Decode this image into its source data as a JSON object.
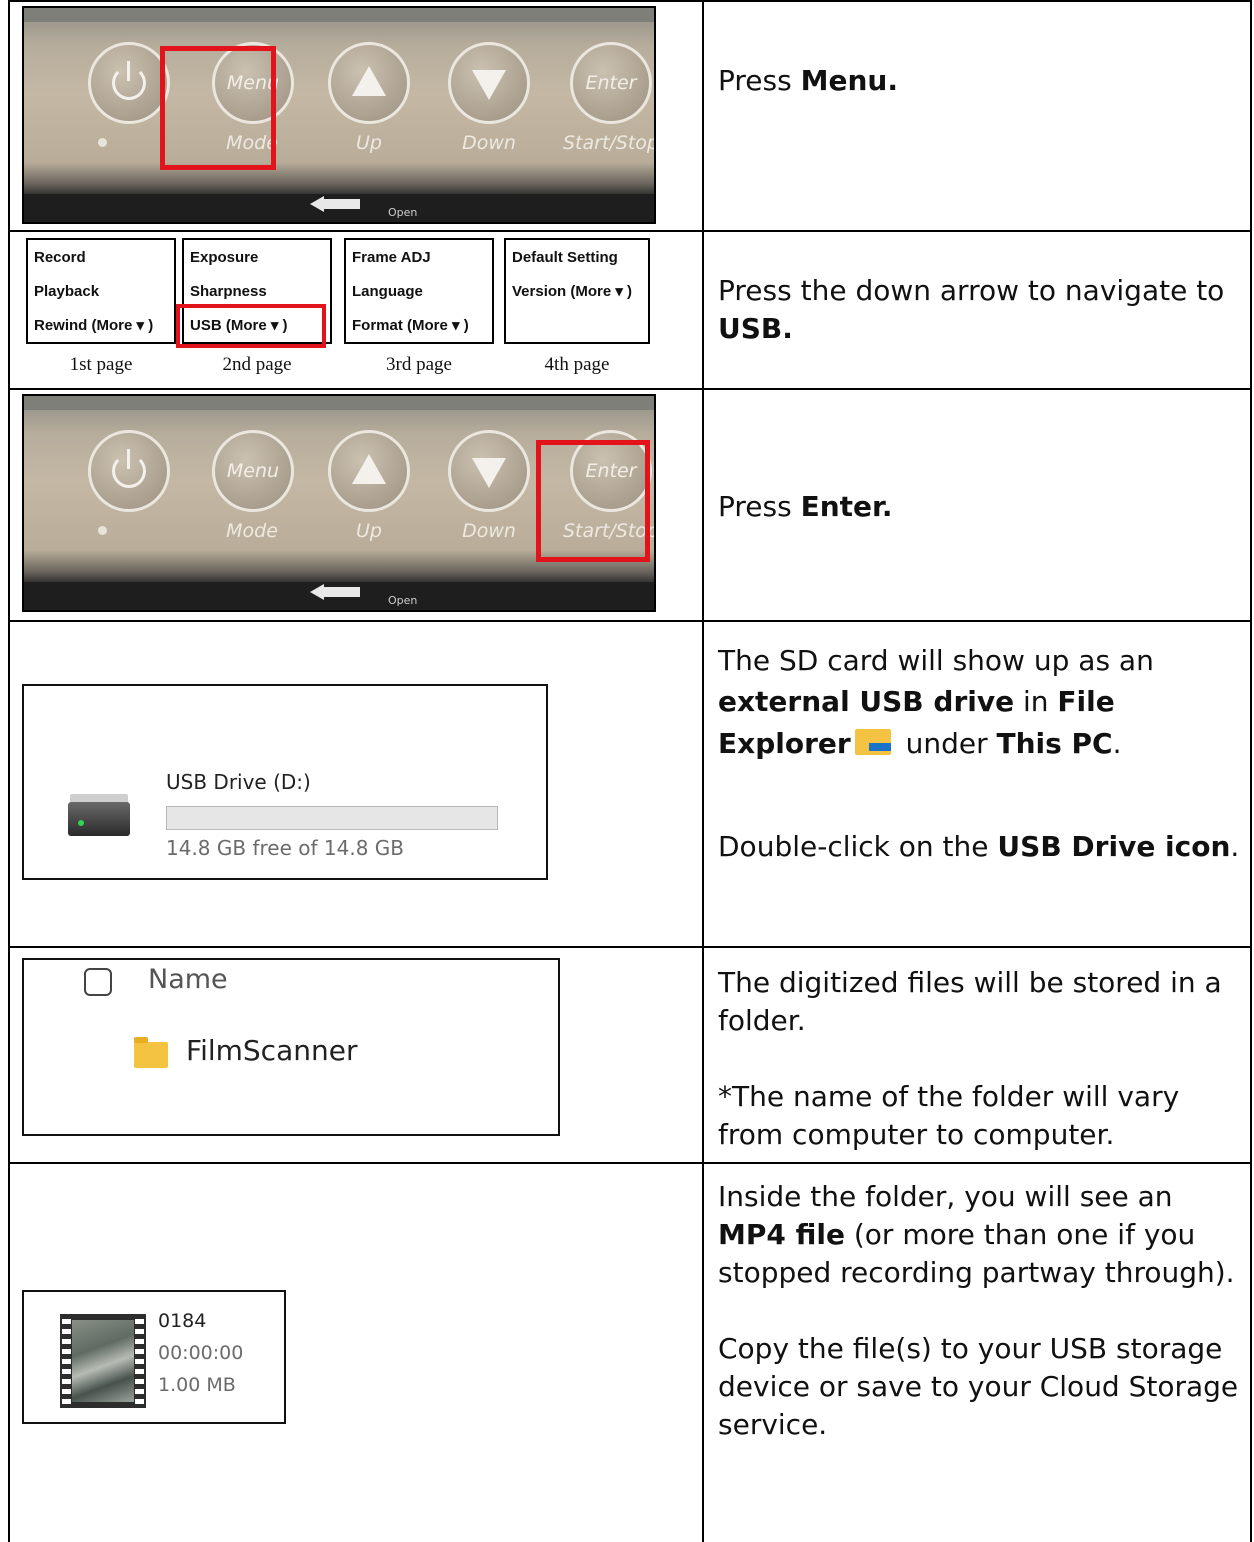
{
  "rows": [
    {
      "panel_buttons": [
        "Menu",
        "Up",
        "Down",
        "Enter"
      ],
      "panel_subs": [
        "Mode",
        "Up",
        "Down",
        "Start/Stop"
      ],
      "open_label": "Open",
      "instruction": {
        "pre": "Press ",
        "bold": "Menu.",
        "post": ""
      }
    },
    {
      "menu_pages": [
        {
          "items": [
            "Record",
            "Playback",
            "Rewind (More ▾ )"
          ],
          "label": "1st page"
        },
        {
          "items": [
            "Exposure",
            "Sharpness",
            "USB (More ▾ )"
          ],
          "label": "2nd page"
        },
        {
          "items": [
            "Frame ADJ",
            "Language",
            "Format (More ▾ )"
          ],
          "label": "3rd page"
        },
        {
          "items": [
            "Default Setting",
            "Version (More ▾ )",
            ""
          ],
          "label": "4th page"
        }
      ],
      "instruction": {
        "pre": "Press the down arrow to navigate to ",
        "bold": "USB.",
        "post": ""
      }
    },
    {
      "open_label": "Open",
      "instruction": {
        "pre": "Press ",
        "bold": "Enter.",
        "post": ""
      }
    },
    {
      "drive_name": "USB Drive (D:)",
      "drive_space": "14.8 GB free of 14.8 GB",
      "drive_used_fraction": 0,
      "p1": {
        "a": "The SD card will show up as an ",
        "b": "external USB drive",
        "c": " in ",
        "d": "File Explorer",
        "e": " under ",
        "f": "This PC",
        "g": "."
      },
      "p2": {
        "a": "Double-click on the ",
        "b": "USB Drive icon",
        "c": "."
      }
    },
    {
      "column_header": "Name",
      "folder_name": "FilmScanner",
      "p1": "The digitized files will be stored in a folder.",
      "p2": "*The name of the folder will vary from computer to computer."
    },
    {
      "file_name": "0184",
      "file_duration": "00:00:00",
      "file_size": "1.00 MB",
      "p1": {
        "a": "Inside the folder, you will see an ",
        "b": "MP4 file",
        "c": " (or more than one if you stopped recording partway through)."
      },
      "p2": "Copy the file(s) to your USB storage device or save to your Cloud Storage service."
    }
  ],
  "colors": {
    "highlight_red": "#e3131b",
    "drive_led": "#2fd64f",
    "folder_yellow": "#f5c342"
  }
}
